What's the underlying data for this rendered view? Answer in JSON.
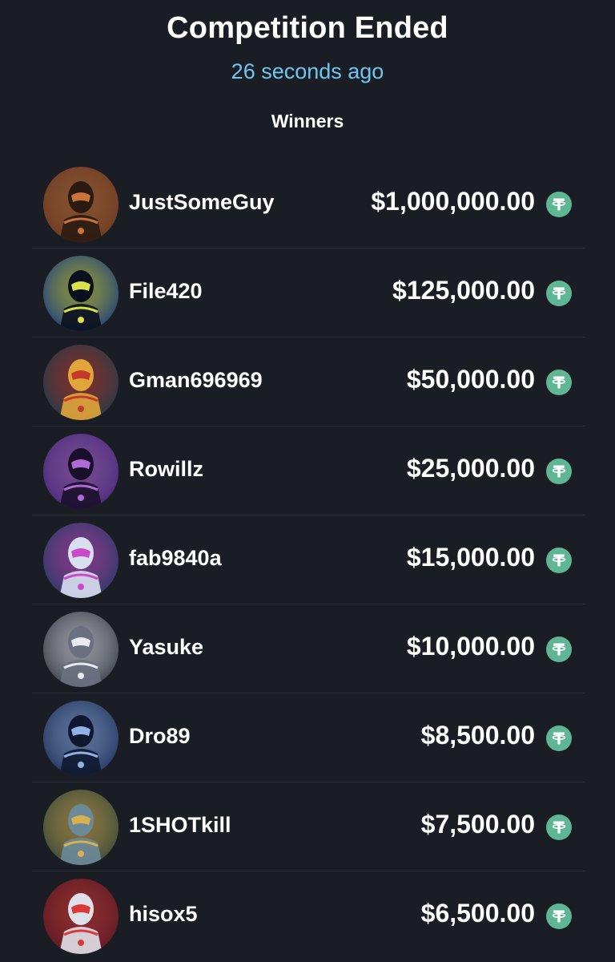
{
  "header": {
    "title": "Competition Ended",
    "subtitle": "26 seconds ago",
    "section_label": "Winners"
  },
  "winners": [
    {
      "username": "JustSomeGuy",
      "amount": "$1,000,000.00",
      "avatar_colors": [
        "#6b3a22",
        "#c9743a",
        "#2b1a12"
      ],
      "avatar_icon": "armored-warrior-avatar"
    },
    {
      "username": "File420",
      "amount": "$125,000.00",
      "avatar_colors": [
        "#1d3d7a",
        "#d8e04a",
        "#0a0f1e"
      ],
      "avatar_icon": "hooded-figure-avatar"
    },
    {
      "username": "Gman696969",
      "amount": "$50,000.00",
      "avatar_colors": [
        "#223a4a",
        "#c23a2a",
        "#e0a63a"
      ],
      "avatar_icon": "red-robot-avatar"
    },
    {
      "username": "Rowillz",
      "amount": "$25,000.00",
      "avatar_colors": [
        "#4a2a78",
        "#b06ad8",
        "#1a0f2a"
      ],
      "avatar_icon": "purple-robot-avatar"
    },
    {
      "username": "fab9840a",
      "amount": "$15,000.00",
      "avatar_colors": [
        "#2a3a66",
        "#c84ac8",
        "#d8e0f0"
      ],
      "avatar_icon": "blue-mecha-avatar"
    },
    {
      "username": "Yasuke",
      "amount": "$10,000.00",
      "avatar_colors": [
        "#3a3f4a",
        "#e8eaf0",
        "#6a7080"
      ],
      "avatar_icon": "white-mecha-avatar"
    },
    {
      "username": "Dro89",
      "amount": "$8,500.00",
      "avatar_colors": [
        "#22355e",
        "#8fb0e8",
        "#0f1830"
      ],
      "avatar_icon": "blue-knight-avatar"
    },
    {
      "username": "1SHOTkill",
      "amount": "$7,500.00",
      "avatar_colors": [
        "#3a4a3a",
        "#d8b050",
        "#6a8a9a"
      ],
      "avatar_icon": "gold-soldier-avatar"
    },
    {
      "username": "hisox5",
      "amount": "$6,500.00",
      "avatar_colors": [
        "#5a1a22",
        "#d83a3a",
        "#e0e0e8"
      ],
      "avatar_icon": "red-samurai-avatar"
    }
  ],
  "token": {
    "icon": "tether-icon",
    "color": "#5eb695"
  }
}
